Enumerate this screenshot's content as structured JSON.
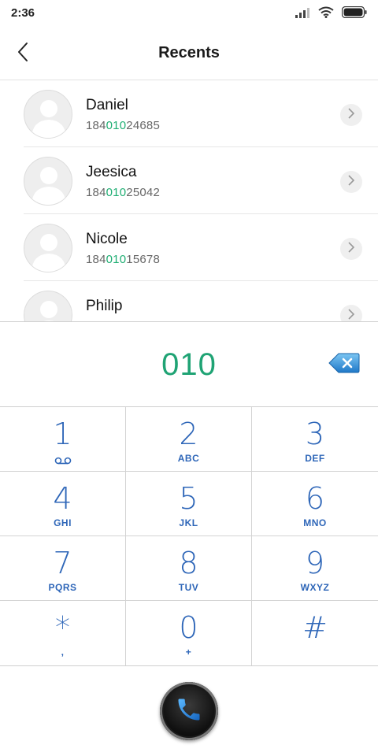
{
  "status": {
    "time": "2:36",
    "icons": [
      "signal-icon",
      "wifi-icon",
      "battery-icon"
    ]
  },
  "header": {
    "title": "Recents",
    "back_icon": "chevron-left-icon"
  },
  "contacts": [
    {
      "name": "Daniel",
      "number_pre": "184",
      "number_match": "010",
      "number_post": "24685"
    },
    {
      "name": "Jeesica",
      "number_pre": "184",
      "number_match": "010",
      "number_post": "25042"
    },
    {
      "name": "Nicole",
      "number_pre": "184",
      "number_match": "010",
      "number_post": "15678"
    },
    {
      "name": "Philip",
      "number_pre": "",
      "number_match": "",
      "number_post": ""
    }
  ],
  "dialer": {
    "input": "010",
    "backspace_icon": "backspace-icon"
  },
  "keypad": [
    {
      "digit": "1",
      "letters": ""
    },
    {
      "digit": "2",
      "letters": "ABC"
    },
    {
      "digit": "3",
      "letters": "DEF"
    },
    {
      "digit": "4",
      "letters": "GHI"
    },
    {
      "digit": "5",
      "letters": "JKL"
    },
    {
      "digit": "6",
      "letters": "MNO"
    },
    {
      "digit": "7",
      "letters": "PQRS"
    },
    {
      "digit": "8",
      "letters": "TUV"
    },
    {
      "digit": "9",
      "letters": "WXYZ"
    },
    {
      "digit": "*",
      "letters": ","
    },
    {
      "digit": "0",
      "letters": "+"
    },
    {
      "digit": "#",
      "letters": ""
    }
  ],
  "call": {
    "icon": "phone-icon"
  },
  "colors": {
    "match_highlight": "#1fae73",
    "dial_text": "#1fa374",
    "keypad_text": "#2e66b8",
    "backspace_accent": "#2a8fd6"
  }
}
